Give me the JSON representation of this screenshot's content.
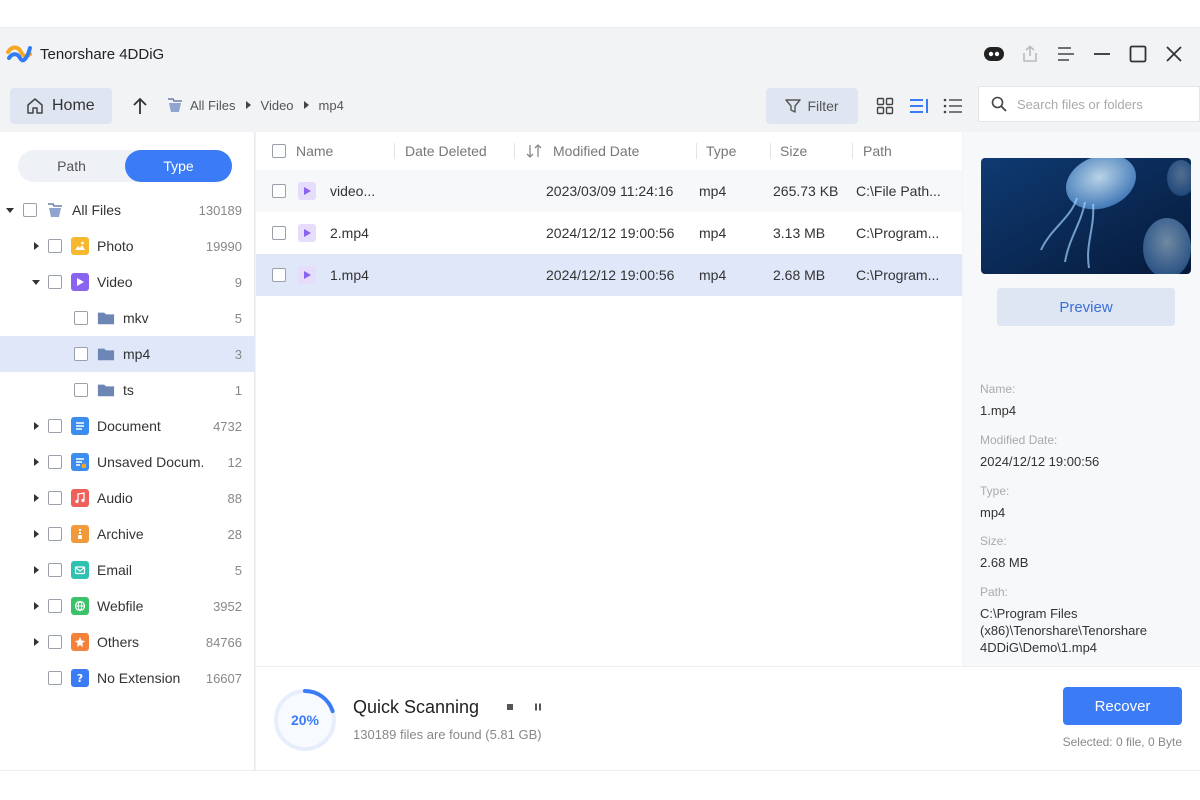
{
  "app": {
    "title": "Tenorshare 4DDiG"
  },
  "toolbar": {
    "home_label": "Home",
    "breadcrumb": [
      "All Files",
      "Video",
      "mp4"
    ],
    "filter_label": "Filter",
    "search_placeholder": "Search files or folders"
  },
  "sidebar": {
    "seg_path": "Path",
    "seg_type": "Type",
    "active_tab": "Type",
    "tree": [
      {
        "label": "All Files",
        "count": "130189",
        "level": 0,
        "expand": "open",
        "icon": "all-files-icon"
      },
      {
        "label": "Photo",
        "count": "19990",
        "level": 1,
        "expand": "closed",
        "icon": "photo-icon",
        "color": "#f5b82e"
      },
      {
        "label": "Video",
        "count": "9",
        "level": 1,
        "expand": "open",
        "icon": "video-icon",
        "color": "#8a63f0"
      },
      {
        "label": "mkv",
        "count": "5",
        "level": 2,
        "expand": "none",
        "icon": "folder-icon"
      },
      {
        "label": "mp4",
        "count": "3",
        "level": 2,
        "expand": "none",
        "icon": "folder-icon",
        "selected": true
      },
      {
        "label": "ts",
        "count": "1",
        "level": 2,
        "expand": "none",
        "icon": "folder-icon"
      },
      {
        "label": "Document",
        "count": "4732",
        "level": 1,
        "expand": "closed",
        "icon": "document-icon",
        "color": "#3b8ef0"
      },
      {
        "label": "Unsaved Docum...",
        "count": "12",
        "level": 1,
        "expand": "closed",
        "icon": "unsaved-document-icon",
        "color": "#3b8ef0"
      },
      {
        "label": "Audio",
        "count": "88",
        "level": 1,
        "expand": "closed",
        "icon": "audio-icon",
        "color": "#f0605a"
      },
      {
        "label": "Archive",
        "count": "28",
        "level": 1,
        "expand": "closed",
        "icon": "archive-icon",
        "color": "#f09a3b"
      },
      {
        "label": "Email",
        "count": "5",
        "level": 1,
        "expand": "closed",
        "icon": "email-icon",
        "color": "#2fc2b0"
      },
      {
        "label": "Webfile",
        "count": "3952",
        "level": 1,
        "expand": "closed",
        "icon": "webfile-icon",
        "color": "#3cc26a"
      },
      {
        "label": "Others",
        "count": "84766",
        "level": 1,
        "expand": "closed",
        "icon": "others-icon",
        "color": "#f5823b"
      },
      {
        "label": "No Extension",
        "count": "16607",
        "level": 1,
        "expand": "none",
        "icon": "no-extension-icon",
        "color": "#3b7cf6"
      }
    ]
  },
  "file_list": {
    "columns": {
      "name": "Name",
      "date_deleted": "Date Deleted",
      "modified_date": "Modified Date",
      "type": "Type",
      "size": "Size",
      "path": "Path"
    },
    "rows": [
      {
        "name": "video...",
        "date_deleted": "",
        "modified_date": "2023/03/09 11:24:16",
        "type": "mp4",
        "size": "265.73 KB",
        "path": "C:\\File Path...",
        "selected": false
      },
      {
        "name": "2.mp4",
        "date_deleted": "",
        "modified_date": "2024/12/12 19:00:56",
        "type": "mp4",
        "size": "3.13 MB",
        "path": "C:\\Program...",
        "selected": false
      },
      {
        "name": "1.mp4",
        "date_deleted": "",
        "modified_date": "2024/12/12 19:00:56",
        "type": "mp4",
        "size": "2.68 MB",
        "path": "C:\\Program...",
        "selected": true
      }
    ]
  },
  "detail": {
    "preview_label": "Preview",
    "name_label": "Name:",
    "name_value": "1.mp4",
    "modified_label": "Modified Date:",
    "modified_value": "2024/12/12 19:00:56",
    "type_label": "Type:",
    "type_value": "mp4",
    "size_label": "Size:",
    "size_value": "2.68 MB",
    "path_label": "Path:",
    "path_value": "C:\\Program Files (x86)\\Tenorshare\\Tenorshare 4DDiG\\Demo\\1.mp4"
  },
  "scan": {
    "progress_percent": 20,
    "progress_text": "20%",
    "title": "Quick Scanning",
    "subtitle": "130189 files are found (5.81 GB)"
  },
  "footer": {
    "recover_label": "Recover",
    "selected_info": "Selected: 0 file, 0 Byte"
  },
  "colors": {
    "accent": "#3b7cf6",
    "selected_row": "#dfe7f9",
    "video_icon": "#8a63f0"
  }
}
